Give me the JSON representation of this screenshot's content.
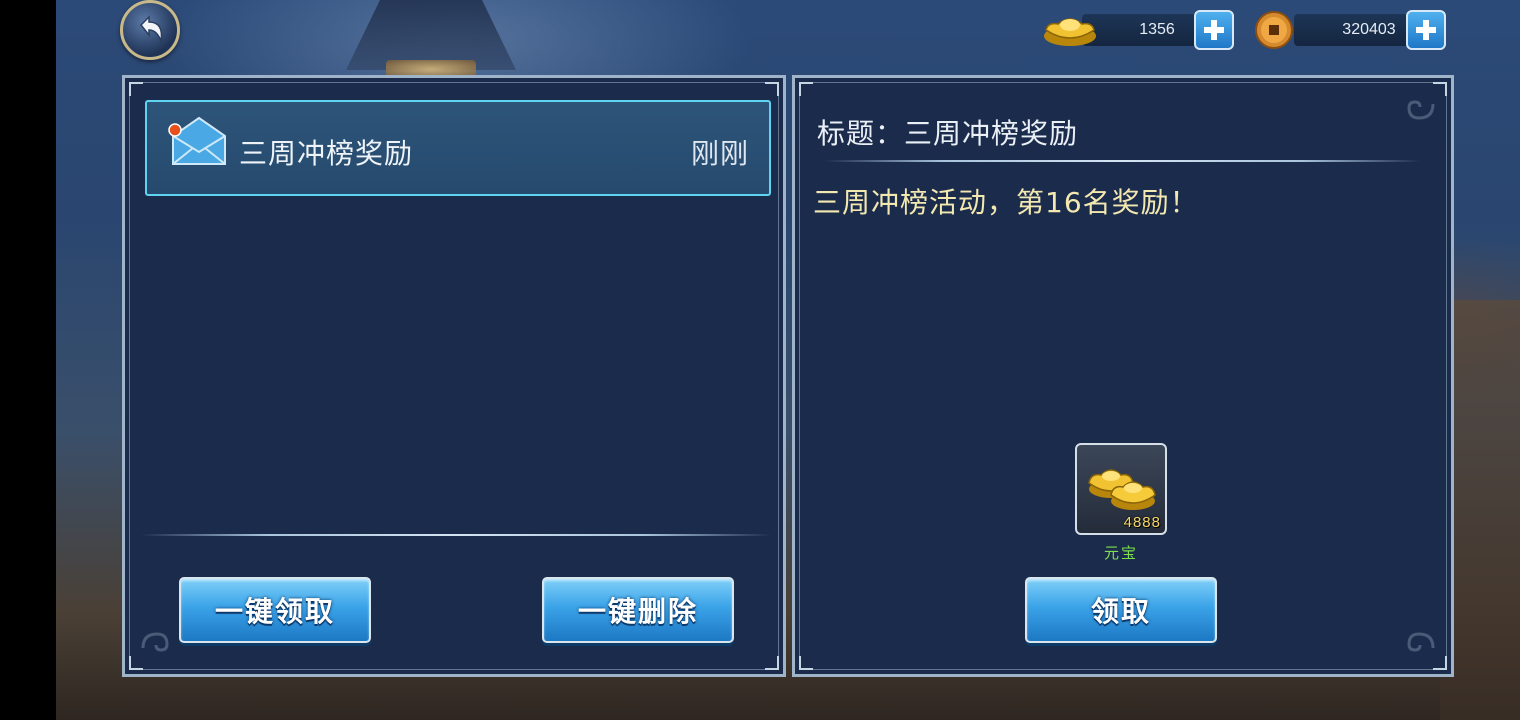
{
  "currency": {
    "gold": {
      "icon": "gold-ingot-icon",
      "value": "1356"
    },
    "coin": {
      "icon": "copper-coin-icon",
      "value": "320403"
    }
  },
  "mail_list": [
    {
      "title": "三周冲榜奖励",
      "time": "刚刚",
      "unread": true
    }
  ],
  "left_buttons": {
    "claim_all": "一键领取",
    "delete_all": "一键删除"
  },
  "detail": {
    "subject": "标题：三周冲榜奖励",
    "body": "三周冲榜活动，第16名奖励！",
    "reward": {
      "icon": "gold-ingot-icon",
      "quantity": "4888",
      "name": "元宝"
    },
    "claim_button": "领取"
  }
}
